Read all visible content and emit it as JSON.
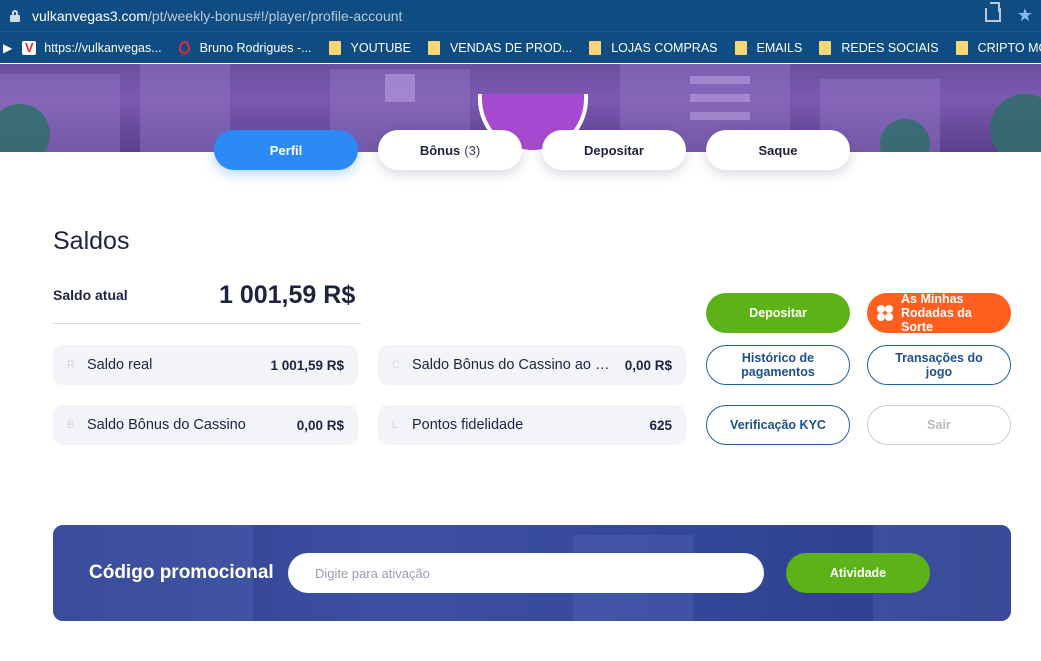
{
  "browser": {
    "url_domain": "vulkanvegas3.com",
    "url_path": "/pt/weekly-bonus#!/player/profile-account",
    "bookmarks": [
      {
        "label": "https://vulkanvegas...",
        "icon": "vulkan-favicon"
      },
      {
        "label": "Bruno Rodrigues -...",
        "icon": "drop-icon"
      },
      {
        "label": "YOUTUBE",
        "icon": "folder-icon"
      },
      {
        "label": "VENDAS DE PROD...",
        "icon": "folder-icon"
      },
      {
        "label": "LOJAS COMPRAS",
        "icon": "folder-icon"
      },
      {
        "label": "EMAILS",
        "icon": "folder-icon"
      },
      {
        "label": "REDES SOCIAIS",
        "icon": "folder-icon"
      },
      {
        "label": "CRIPTO MOEDAS",
        "icon": "folder-icon"
      }
    ]
  },
  "tabs": [
    {
      "label": "Perfil",
      "active": true
    },
    {
      "label": "Bônus",
      "count": "(3)"
    },
    {
      "label": "Depositar"
    },
    {
      "label": "Saque"
    }
  ],
  "balances": {
    "title": "Saldos",
    "current_label": "Saldo atual",
    "current_value": "1 001,59 R$",
    "items": [
      {
        "letter": "R",
        "label": "Saldo real",
        "value": "1 001,59 R$"
      },
      {
        "letter": "C",
        "label": "Saldo Bônus do Cassino ao Vivo",
        "value": "0,00 R$"
      },
      {
        "letter": "B",
        "label": "Saldo Bônus do Cassino",
        "value": "0,00 R$"
      },
      {
        "letter": "L",
        "label": "Pontos fidelidade",
        "value": "625"
      }
    ]
  },
  "actions": {
    "deposit": "Depositar",
    "lucky_spins": "As Minhas Rodadas da Sorte",
    "payment_history": "Histórico de pagamentos",
    "game_transactions": "Transações do jogo",
    "kyc": "Verificação KYC",
    "logout": "Sair"
  },
  "promo": {
    "label": "Código promocional",
    "placeholder": "Digite para ativação",
    "button": "Atividade"
  },
  "colors": {
    "browser_bar": "#0f4c81",
    "tab_active": "#2b8af6",
    "green": "#5cb217",
    "orange": "#ff5f1f",
    "outline_blue": "#1f5fa8",
    "text_dark": "#1e2341"
  }
}
